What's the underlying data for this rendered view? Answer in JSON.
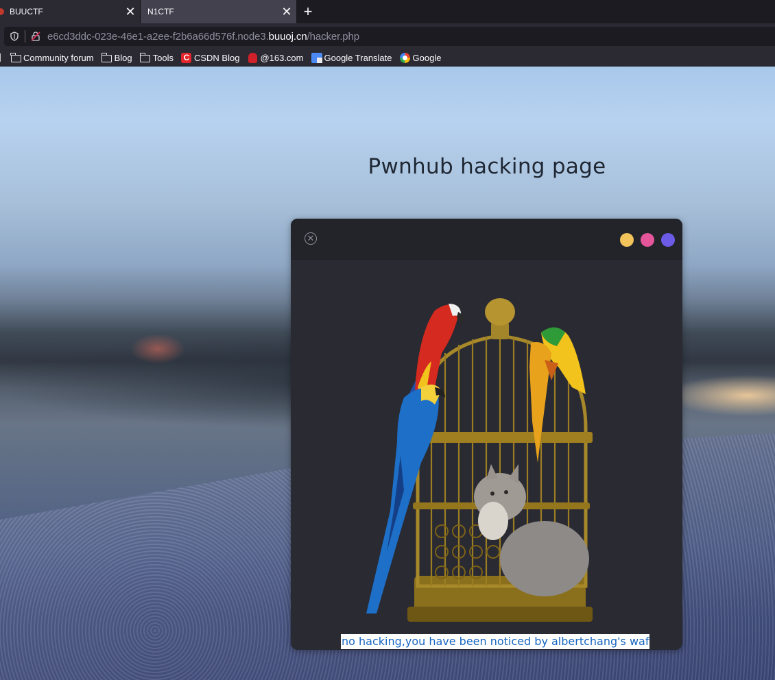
{
  "browser": {
    "tabs": [
      {
        "title": "BUUCTF",
        "active": false
      },
      {
        "title": "N1CTF",
        "active": true
      }
    ],
    "new_tab_label": "+",
    "close_glyph": "✕",
    "url": {
      "prefix": "e6cd3ddc-023e-46e1-a2ee-f2b6a66d576f.node3.",
      "domain": "buuoj.cn",
      "path": "/hacker.php"
    },
    "bookmarks": [
      {
        "label": "Community forum",
        "icon": "folder-icon"
      },
      {
        "label": "Blog",
        "icon": "folder-icon"
      },
      {
        "label": "Tools",
        "icon": "folder-icon"
      },
      {
        "label": "CSDN Blog",
        "icon": "csdn-icon"
      },
      {
        "label": "@163.com",
        "icon": "netease-icon"
      },
      {
        "label": "Google Translate",
        "icon": "google-translate-icon"
      },
      {
        "label": "Google",
        "icon": "google-icon"
      }
    ]
  },
  "page": {
    "title": "Pwnhub hacking page",
    "terminal": {
      "dots": [
        "#f3c35c",
        "#e4559a",
        "#6b5be6"
      ],
      "message": "no hacking,you have been noticed by albertchang's waf"
    }
  }
}
